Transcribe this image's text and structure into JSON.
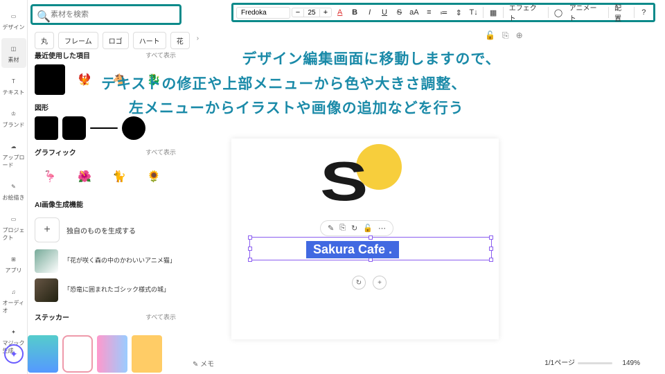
{
  "search": {
    "placeholder": "素材を検索"
  },
  "leftnav": [
    {
      "label": "デザイン",
      "icon": "▭"
    },
    {
      "label": "素材",
      "icon": "◫"
    },
    {
      "label": "テキスト",
      "icon": "T"
    },
    {
      "label": "ブランド",
      "icon": "♔"
    },
    {
      "label": "アップロード",
      "icon": "☁"
    },
    {
      "label": "お絵描き",
      "icon": "✎"
    },
    {
      "label": "プロジェクト",
      "icon": "▭"
    },
    {
      "label": "アプリ",
      "icon": "⊞"
    },
    {
      "label": "オーディオ",
      "icon": "♫"
    },
    {
      "label": "マジック生成",
      "icon": "✦"
    }
  ],
  "tags": [
    "丸",
    "フレーム",
    "ロゴ",
    "ハート",
    "花"
  ],
  "sections": {
    "recent": {
      "title": "最近使用した項目",
      "all": "すべて表示"
    },
    "shapes": {
      "title": "図形"
    },
    "graphics": {
      "title": "グラフィック",
      "all": "すべて表示"
    },
    "ai": {
      "title": "AI画像生成機能",
      "generate": "独自のものを生成する",
      "items": [
        "「花が咲く森の中のかわいいアニメ猫」",
        "「恐竜に囲まれたゴシック様式の城」"
      ]
    },
    "stickers": {
      "title": "ステッカー",
      "all": "すべて表示"
    }
  },
  "toolbar": {
    "font": "Fredoka",
    "size": "25",
    "effect": "エフェクト",
    "animate": "アニメート",
    "arrange": "配置"
  },
  "canvas": {
    "text": "Sakura Cafe ."
  },
  "overlay": {
    "l1": "デザイン編集画面に移動しますので、",
    "l2": "テキストの修正や上部メニューから色や大きさ調整、",
    "l3": "左メニューからイラストや画像の追加などを行う"
  },
  "bottom": {
    "memo": "メモ",
    "pager": "1/1ページ",
    "zoom": "149%"
  }
}
